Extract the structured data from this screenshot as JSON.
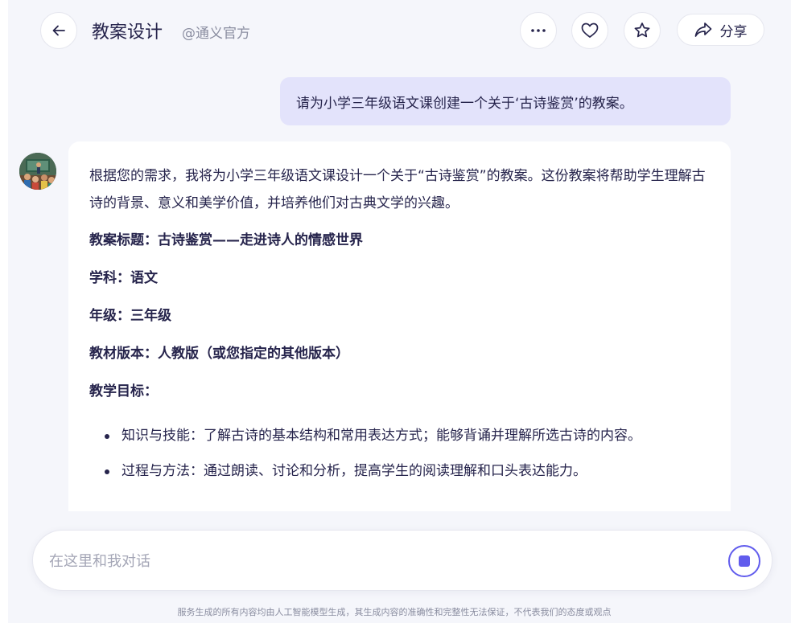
{
  "header": {
    "title": "教案设计",
    "author": "@通义官方",
    "share_label": "分享"
  },
  "icons": {
    "back": "arrow-left-icon",
    "more": "ellipsis-icon",
    "like": "heart-icon",
    "favorite": "star-icon",
    "share": "share-arrow-icon",
    "send": "stop-icon"
  },
  "user_message": "请为小学三年级语文课创建一个关于‘古诗鉴赏’的教案。",
  "assistant": {
    "intro": "根据您的需求，我将为小学三年级语文课设计一个关于“古诗鉴赏”的教案。这份教案将帮助学生理解古诗的背景、意义和美学价值，并培养他们对古典文学的兴趣。",
    "lines": [
      "教案标题：古诗鉴赏——走进诗人的情感世界",
      "学科：语文",
      "年级：三年级",
      "教材版本：人教版（或您指定的其他版本）",
      "教学目标："
    ],
    "bullets": [
      "知识与技能：了解古诗的基本结构和常用表达方式；能够背诵并理解所选古诗的内容。",
      "过程与方法：通过朗读、讨论和分析，提高学生的阅读理解和口头表达能力。"
    ]
  },
  "input": {
    "placeholder": "在这里和我对话",
    "value": ""
  },
  "disclaimer": "服务生成的所有内容均由人工智能模型生成，其生成内容的准确性和完整性无法保证，不代表我们的态度或观点",
  "colors": {
    "accent": "#615ced",
    "user_bubble": "#e3e3fb",
    "background": "#f5f6fb"
  }
}
